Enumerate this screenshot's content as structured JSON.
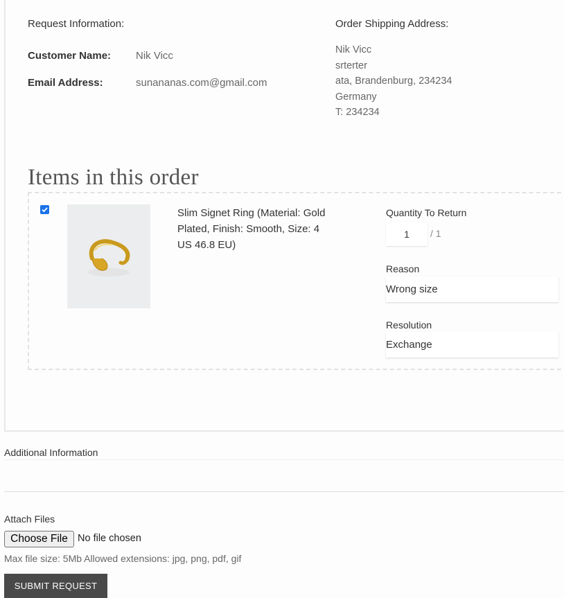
{
  "request_info": {
    "heading": "Request Information:",
    "customer_name_label": "Customer Name:",
    "customer_name": "Nik Vicc",
    "email_label": "Email Address:",
    "email": "sunananas.com@gmail.com"
  },
  "shipping": {
    "heading": "Order Shipping Address:",
    "lines": [
      "Nik Vicc",
      "srterter",
      "ata, Brandenburg, 234234",
      "Germany",
      "T: 234234"
    ]
  },
  "items": {
    "title": "Items in this order",
    "list": [
      {
        "checked": true,
        "name": "Slim Signet Ring (Material: Gold Plated, Finish: Smooth, Size: 4 US 46.8 EU)",
        "image_icon": "gold-ring-image",
        "quantity_label": "Quantity To Return",
        "quantity": "1",
        "quantity_max": "/ 1",
        "reason_label": "Reason",
        "reason": "Wrong size",
        "resolution_label": "Resolution",
        "resolution": "Exchange"
      }
    ]
  },
  "additional_info": {
    "label": "Additional Information",
    "value": ""
  },
  "attach": {
    "label": "Attach Files",
    "button": "Choose File",
    "status": "No file chosen",
    "hint": "Max file size: 5Mb Allowed extensions: jpg, png, pdf, gif"
  },
  "submit": {
    "label": "SUBMIT REQUEST"
  },
  "colors": {
    "submit_bg": "#494949",
    "checkbox": "#1a73e8"
  }
}
